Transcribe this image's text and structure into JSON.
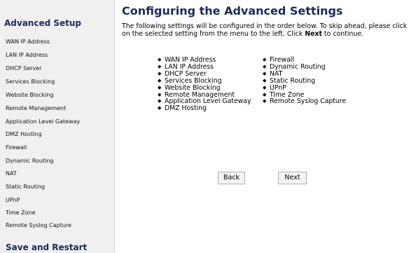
{
  "sidebar": {
    "title": "Advanced Setup",
    "items": [
      {
        "label": "WAN IP Address"
      },
      {
        "label": "LAN IP Address"
      },
      {
        "label": "DHCP Server"
      },
      {
        "label": "Services Blocking"
      },
      {
        "label": "Website Blocking"
      },
      {
        "label": "Remote Management"
      },
      {
        "label": "Application Level Gateway"
      },
      {
        "label": "DMZ Hosting"
      },
      {
        "label": "Firewall"
      },
      {
        "label": "Dynamic Routing"
      },
      {
        "label": "NAT"
      },
      {
        "label": "Static Routing"
      },
      {
        "label": "UPnP"
      },
      {
        "label": "Time Zone"
      },
      {
        "label": "Remote Syslog Capture"
      }
    ],
    "save_restart": "Save and Restart"
  },
  "main": {
    "title": "Configuring the Advanced Settings",
    "intro_before": "The following settings will be configured in the order below. To skip ahead, please click on the selected setting from the menu to the left. Click ",
    "intro_bold": "Next",
    "intro_after": " to continue.",
    "bullet": "◆",
    "list_col1": [
      "WAN IP Address",
      "LAN IP Address",
      "DHCP Server",
      "Services Blocking",
      "Website Blocking",
      "Remote Management",
      "Application Level Gateway",
      "DMZ Hosting"
    ],
    "list_col2": [
      "Firewall",
      "Dynamic Routing",
      "NAT",
      "Static Routing",
      "UPnP",
      "Time Zone",
      "Remote Syslog Capture"
    ],
    "back_label": "Back",
    "next_label": "Next"
  },
  "colors": {
    "title": "#1a2a5a",
    "sidebar_bg": "#f0f0f0"
  }
}
